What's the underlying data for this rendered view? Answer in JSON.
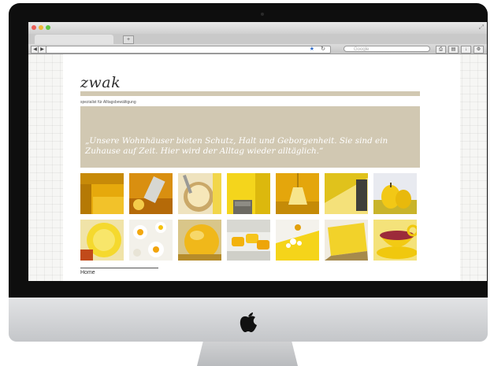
{
  "browser": {
    "tab_label": "",
    "new_tab_label": "+",
    "back_label": "◀",
    "forward_label": "▶",
    "url": "",
    "bookmark_icon": "star-icon",
    "reload_label": "↻",
    "search_placeholder": "Google",
    "colors": {
      "close": "#ec5f58",
      "minimize": "#f0b735",
      "zoom": "#5fc644"
    }
  },
  "site": {
    "logo": "zwak",
    "tagline": "spezialist für Alltagsbewältigung",
    "quote": "„Unsere Wohnhäuser bieten Schutz, Halt und Geborgenheit. Sie sind ein Zuhause auf Zeit. Hier wird der Alltag wieder alltäglich.“",
    "accent_color": "#d1c8b2",
    "footer_link": "Home"
  },
  "gallery": {
    "tiles": [
      {
        "subject": "yellow kitchen"
      },
      {
        "subject": "cheese grater"
      },
      {
        "subject": "whisk in bowl"
      },
      {
        "subject": "yellow door"
      },
      {
        "subject": "yellow lamp"
      },
      {
        "subject": "yellow wall corner"
      },
      {
        "subject": "yellow pears"
      },
      {
        "subject": "yellow plate"
      },
      {
        "subject": "eggs"
      },
      {
        "subject": "quince"
      },
      {
        "subject": "yellow sponges"
      },
      {
        "subject": "yellow tray"
      },
      {
        "subject": "yellow pillow"
      },
      {
        "subject": "yellow teacup"
      }
    ]
  }
}
